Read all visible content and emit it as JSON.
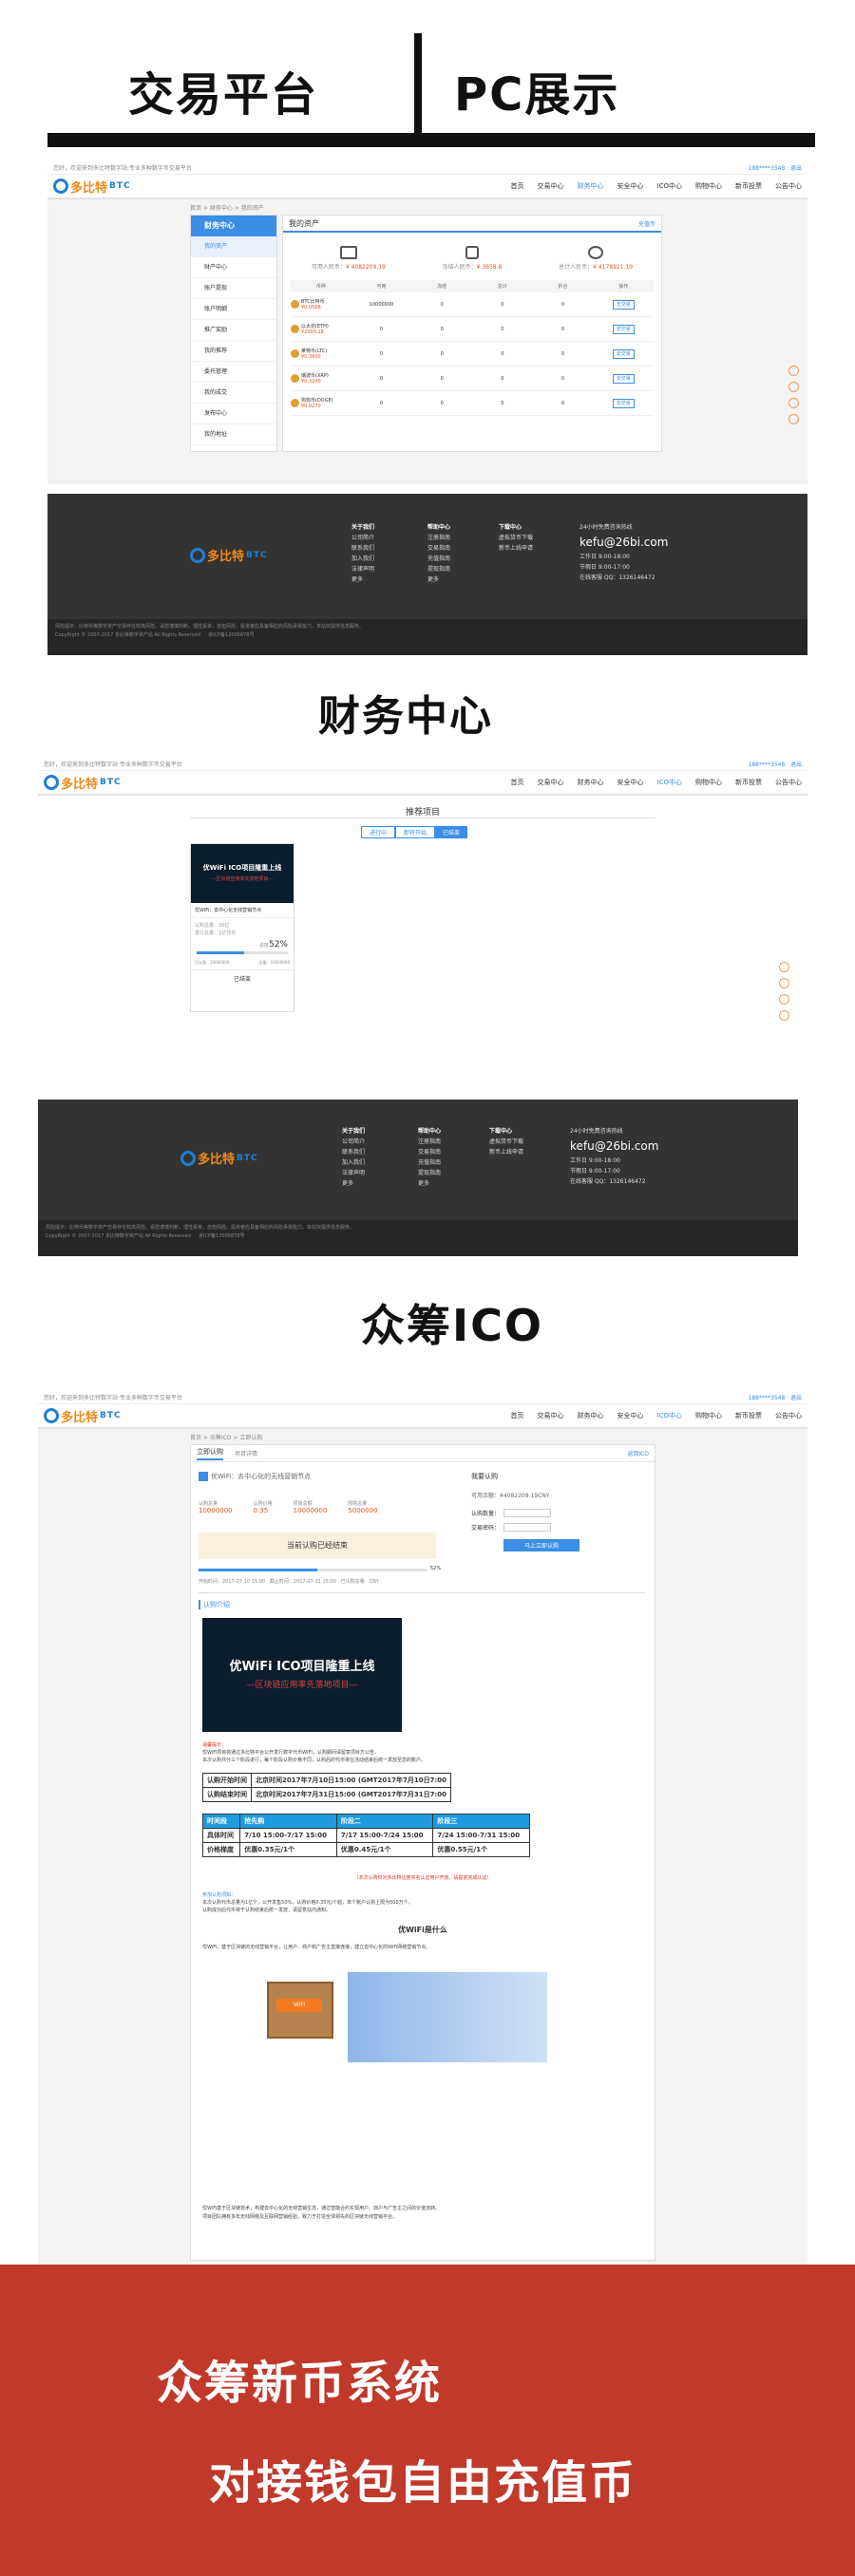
{
  "headings": {
    "trading_platform": "交易平台",
    "pc_display": "PC展示",
    "finance_center": "财务中心",
    "crowdfunding_ico": "众筹ICO",
    "banner_line1": "众筹新币系统",
    "banner_line2": "对接钱包自由充值币"
  },
  "site": {
    "logo_cn": "多比特",
    "logo_en": "BTC",
    "top_left": "您好，欢迎来到多比特数字站·专业多种数字币交易平台",
    "top_right": "188****3548 · 退出",
    "nav": [
      "首页",
      "交易中心",
      "财务中心",
      "安全中心",
      "ICO中心",
      "购物中心",
      "新币投票",
      "公告中心"
    ],
    "icons": {
      "logo": "coin-logo-icon",
      "chat": "chat-icon",
      "qq": "qq-icon",
      "phone": "phone-icon",
      "top": "back-to-top-icon"
    }
  },
  "finance": {
    "breadcrumb": "首页 > 财务中心 > 我的资产",
    "sidebar_title": "财务中心",
    "sidebar": [
      "我的资产",
      "财产中心",
      "账户提现",
      "账户明细",
      "推广奖励",
      "我的推荐",
      "委托管理",
      "我的成交",
      "发布中心",
      "我的地址"
    ],
    "panel_title": "我的资产",
    "recharge_link": "充值币",
    "summary": [
      {
        "label": "可用人民币：",
        "value": "¥ 4082209.19"
      },
      {
        "label": "冻结人民币：",
        "value": "¥ 3658.8"
      },
      {
        "label": "总计人民币：",
        "value": "¥ 4178921.19"
      }
    ],
    "columns": [
      "币种",
      "可用",
      "冻结",
      "总计",
      "折合",
      "操作"
    ],
    "rows": [
      {
        "coin": "BTC比特币",
        "price": "¥0.0508",
        "avail": "10000000",
        "frozen": "0",
        "total": "0",
        "value": "0",
        "action": "去交易"
      },
      {
        "coin": "以太坊(ETH)",
        "price": "¥2000.18",
        "avail": "0",
        "frozen": "0",
        "total": "0",
        "value": "0",
        "action": "去交易"
      },
      {
        "coin": "莱特币(LTC)",
        "price": "¥0.3800",
        "avail": "0",
        "frozen": "0",
        "total": "0",
        "value": "0",
        "action": "去交易"
      },
      {
        "coin": "瑞波币(XRP)",
        "price": "¥0.3200",
        "avail": "0",
        "frozen": "0",
        "total": "0",
        "value": "0",
        "action": "去交易"
      },
      {
        "coin": "狗狗币(DOGE)",
        "price": "¥0.0270",
        "avail": "0",
        "frozen": "0",
        "total": "0",
        "value": "0",
        "action": "去交易"
      }
    ]
  },
  "footer": {
    "col1": {
      "title": "关于我们",
      "items": [
        "公司简介",
        "联系我们",
        "加入我们",
        "法律声明",
        "更多"
      ]
    },
    "col2": {
      "title": "帮助中心",
      "items": [
        "注册指南",
        "交易指南",
        "充值指南",
        "提现指南",
        "更多"
      ]
    },
    "col3": {
      "title": "下载中心",
      "items": [
        "虚拟货币下载",
        "新币上线申请"
      ]
    },
    "service_title": "24小时免费咨询热线",
    "email": "kefu@26bi.com",
    "hours1": "工作日 9:00-18:00",
    "hours2": "节假日 9:00-17:00",
    "qq": "在线客服 QQ：1326146472",
    "disclaimer": "风险提示：比特币等数字资产交易存在较高风险，请您谨慎判断，理性投资，自担风险，投资者应具备相应的风险承受能力。本站仅提供信息服务。",
    "copyright": "CopyRight © 2007-2017 多比特数字资产站 All Rights Reserved 　 京ICP备12005878号"
  },
  "ico": {
    "breadcrumb": "首页 > ICO > 推荐项目",
    "page_title": "推荐项目",
    "tabs": [
      "进行中",
      "即将开始",
      "已结束"
    ],
    "card_banner": "优WiFi ICO项目隆重上线",
    "card_sub": "—区块链应用率先落地项目—",
    "card_title": "优WiFi：去中心化无线营销节点",
    "card_total": "认购总量：30亿",
    "card_issue": "发行总量：1亿代币",
    "progress_label": "进度",
    "progress": "52%",
    "card_meta1": "已认购：10000000",
    "card_meta2": "总量：10000000",
    "card_button": "已结束"
  },
  "detail": {
    "breadcrumb": "首页 > 众筹ICO > 立即认购",
    "tab_active": "立即认购",
    "tab_other": "项目详情",
    "back_link": "返回ICO",
    "project_title": "优WiFi：去中心化的无线营销节点",
    "stats": [
      {
        "label": "认购总量",
        "value": "10000000"
      },
      {
        "label": "认购价格",
        "value": "0.35"
      },
      {
        "label": "项目总额",
        "value": "10000000"
      },
      {
        "label": "限购总量",
        "value": "5000000"
      }
    ],
    "ended_notice": "当前认购已经结束",
    "progress": "52%",
    "dates": "开始时间：2017-07-10 15:00 · 截止时间：2017-07-31 15:00 · 已认购总量：CNY",
    "buy_title": "我要认购",
    "avail_label": "可用余额：¥4082209.19CNY",
    "qty_label": "认购数量：",
    "pwd_label": "交易密码：",
    "buy_button": "马上立即认购",
    "intro_heading": "认购介绍",
    "poster_title": "优WiFi ICO项目隆重上线",
    "poster_sub": "—区块链应用率先落地项目—",
    "note_red": "温馨提示：",
    "note_lines": [
      "优WiFi项目将通过多比特平台公开发行数字代币WIFI，认购期间请留意项目方公告。",
      "本次认购共分三个阶段进行，每个阶段认购价格不同，认购后的代币将在活动结束后统一发放至您的账户。"
    ],
    "schedule": [
      {
        "label": "认购开始时间",
        "value": "北京时间2017年7月10日15:00 (GMT2017年7月10日7:00"
      },
      {
        "label": "认购结束时间",
        "value": "北京时间2017年7月31日15:00 (GMT2017年7月31日7:00"
      }
    ],
    "phases_header": [
      "时间段",
      "抢先购",
      "阶段二",
      "阶段三"
    ],
    "phases_rows": [
      [
        "具体时间",
        "7/10 15:00-7/17 15:00",
        "7/17 15:00-7/24 15:00",
        "7/24 15:00-7/31 15:00"
      ],
      [
        "价格梯度",
        "优惠0.35元/1个",
        "优惠0.45元/1个",
        "优惠0.55元/1个"
      ]
    ],
    "red_note": "（本次认购仅对多比特注册实名认证用户开放，请提前完成认证）",
    "rules_heading": "参加认购须知：",
    "rules_lines": [
      "本次认购代币总量为1亿个，公开发售50%，认购价格0.35元/个起，单个账户认购上限为500万个。",
      "认购成功后代币将于认购结束后统一发放，请留意站内通知。"
    ],
    "what_heading": "优WiFi是什么",
    "what_text": "优WiFi，基于区块链的无线营销平台，让用户、商户和广告主直接连接，建立去中心化的WiFi网络营销节点。",
    "bottom_text": [
      "优WiFi基于区块链技术，构建去中心化的无线营销生态，通过智能合约实现用户、商户与广告主之间的价值流转。",
      "项目团队拥有多年无线网络及互联网营销经验，致力于打造全球领先的区块链无线营销平台。"
    ]
  }
}
